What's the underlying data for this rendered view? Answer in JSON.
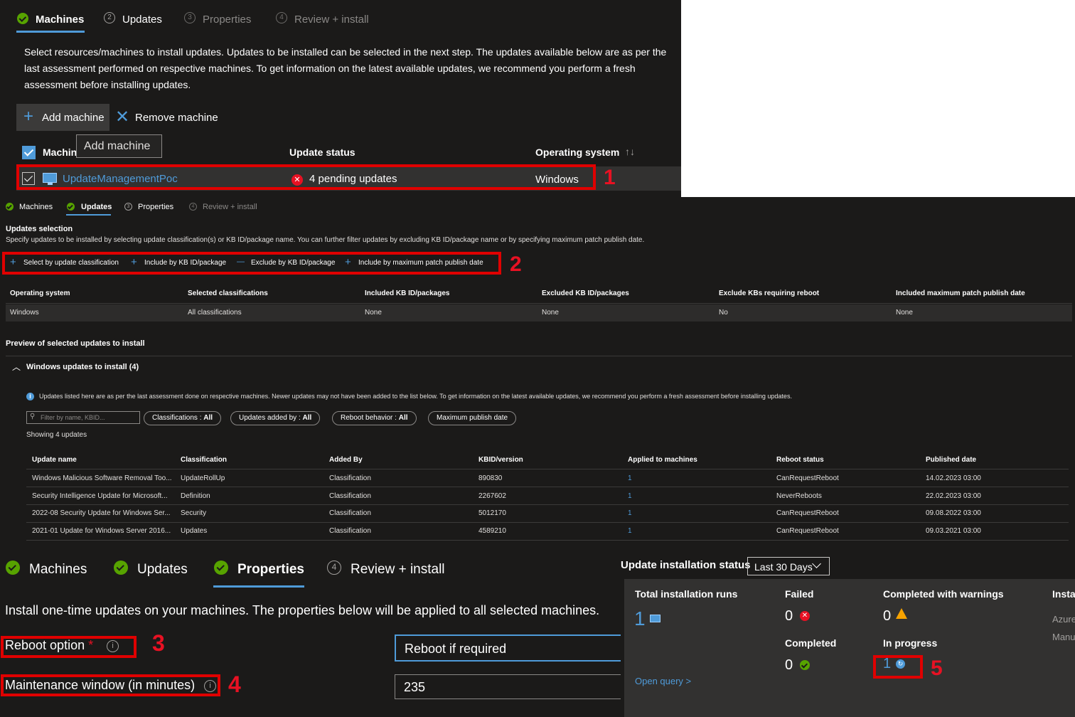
{
  "panel1": {
    "tabs": [
      {
        "num": "",
        "label": "Machines",
        "state": "done"
      },
      {
        "num": "2",
        "label": "Updates",
        "state": "next"
      },
      {
        "num": "3",
        "label": "Properties",
        "state": "disabled"
      },
      {
        "num": "4",
        "label": "Review + install",
        "state": "disabled"
      }
    ],
    "description": "Select resources/machines to install updates. Updates to be installed can be selected in the next step. The updates available below are as per the last assessment performed on respective machines. To get information on the latest available updates, we recommend you perform a fresh assessment before installing updates.",
    "toolbar": {
      "add_label": "Add machine",
      "remove_label": "Remove machine"
    },
    "tooltip": "Add machine",
    "columns": {
      "machine": "Machin",
      "update_status": "Update status",
      "os": "Operating system"
    },
    "row": {
      "name": "UpdateManagementPoc",
      "status": "4 pending updates",
      "os": "Windows"
    },
    "callout": "1"
  },
  "panel2": {
    "tabs": [
      {
        "num": "",
        "label": "Machines",
        "state": "done"
      },
      {
        "num": "",
        "label": "Updates",
        "state": "done"
      },
      {
        "num": "3",
        "label": "Properties",
        "state": "next"
      },
      {
        "num": "4",
        "label": "Review + install",
        "state": "disabled"
      }
    ],
    "section_title": "Updates selection",
    "section_desc": "Specify updates to be installed by selecting update classification(s) or KB ID/package name. You can further filter updates by excluding KB ID/package name or by specifying maximum patch publish date.",
    "toolbar": [
      {
        "icon": "+",
        "label": "Select by update classification"
      },
      {
        "icon": "+",
        "label": "Include by KB ID/package"
      },
      {
        "icon": "—",
        "label": "Exclude by KB ID/package"
      },
      {
        "icon": "+",
        "label": "Include by maximum patch publish date"
      }
    ],
    "callout": "2",
    "summary_headers": [
      "Operating system",
      "Selected classifications",
      "Included KB ID/packages",
      "Excluded KB ID/packages",
      "Exclude KBs requiring reboot",
      "Included maximum patch publish date"
    ],
    "summary_row": [
      "Windows",
      "All classifications",
      "None",
      "None",
      "No",
      "None"
    ],
    "preview_title": "Preview of selected updates to install",
    "group_title": "Windows updates to install (4)",
    "info_text": "Updates listed here are as per the last assessment done on respective machines. Newer updates may not have been added to the list below. To get information on the latest available updates, we recommend you perform a fresh assessment before installing updates.",
    "filter_placeholder": "Filter by name, KBID...",
    "filters": [
      {
        "label": "Classifications : ",
        "value": "All"
      },
      {
        "label": "Updates added by : ",
        "value": "All"
      },
      {
        "label": "Reboot behavior : ",
        "value": "All"
      },
      {
        "label": "Maximum publish date",
        "value": ""
      }
    ],
    "showing": "Showing 4 updates",
    "update_headers": [
      "Update name",
      "Classification",
      "Added By",
      "KBID/version",
      "Applied to machines",
      "Reboot status",
      "Published date"
    ],
    "updates": [
      [
        "Windows Malicious Software Removal Too...",
        "UpdateRollUp",
        "Classification",
        "890830",
        "1",
        "CanRequestReboot",
        "14.02.2023 03:00"
      ],
      [
        "Security Intelligence Update for Microsoft...",
        "Definition",
        "Classification",
        "2267602",
        "1",
        "NeverReboots",
        "22.02.2023 03:00"
      ],
      [
        "2022-08 Security Update for Windows Ser...",
        "Security",
        "Classification",
        "5012170",
        "1",
        "CanRequestReboot",
        "09.08.2022 03:00"
      ],
      [
        "2021-01 Update for Windows Server 2016...",
        "Updates",
        "Classification",
        "4589210",
        "1",
        "CanRequestReboot",
        "09.03.2021 03:00"
      ]
    ]
  },
  "panel3": {
    "tabs": [
      {
        "num": "",
        "label": "Machines",
        "state": "done"
      },
      {
        "num": "",
        "label": "Updates",
        "state": "done"
      },
      {
        "num": "",
        "label": "Properties",
        "state": "active"
      },
      {
        "num": "4",
        "label": "Review + install",
        "state": "next"
      }
    ],
    "description": "Install one-time updates on your machines. The properties below will be applied to all selected machines.",
    "reboot_label": "Reboot option",
    "required_mark": "*",
    "reboot_value": "Reboot if required",
    "window_label": "Maintenance window (in minutes)",
    "window_value": "235",
    "callout_reboot": "3",
    "callout_window": "4"
  },
  "panel4": {
    "title": "Update installation status",
    "range": "Last 30 Days",
    "total_label": "Total installation runs",
    "total_value": "1",
    "failed_label": "Failed",
    "failed_value": "0",
    "warnings_label": "Completed with warnings",
    "warnings_value": "0",
    "completed_label": "Completed",
    "completed_value": "0",
    "progress_label": "In progress",
    "progress_value": "1",
    "partial_label": "Insta",
    "partial_item1": "Azure",
    "partial_item2": "Manu",
    "open_query": "Open query >",
    "callout": "5"
  }
}
